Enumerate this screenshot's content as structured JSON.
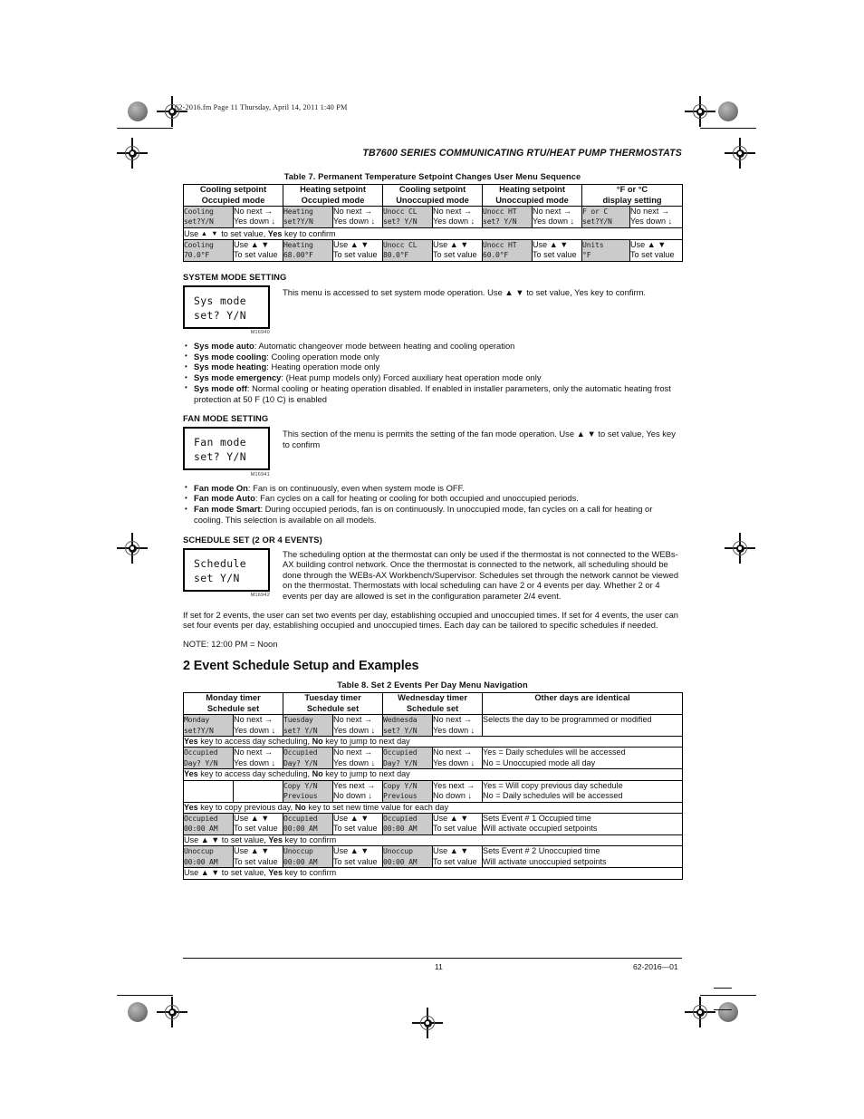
{
  "header": {
    "fm_stamp": "62-2016.fm  Page 11  Thursday, April 14, 2011  1:40 PM",
    "running_head": "TB7600 SERIES COMMUNICATING RTU/HEAT PUMP THERMOSTATS"
  },
  "footer": {
    "page_number": "11",
    "doc_number": "62-2016—01"
  },
  "table7": {
    "caption": "Table 7.  Permanent Temperature Setpoint Changes User Menu Sequence",
    "headers": [
      "Cooling setpoint\nOccupied mode",
      "Heating setpoint\nOccupied mode",
      "Cooling setpoint\nUnoccupied mode",
      "Heating setpoint\nUnoccupied mode",
      "°F or °C\ndisplay setting"
    ],
    "row1": [
      {
        "lcd": "Cooling\nset?Y/N",
        "act": "No next →\nYes down ↓"
      },
      {
        "lcd": "Heating\nset?Y/N",
        "act": "No next →\nYes down ↓"
      },
      {
        "lcd": "Unocc CL\nset? Y/N",
        "act": "No next →\nYes down ↓"
      },
      {
        "lcd": "Unocc HT\nset? Y/N",
        "act": "No next →\nYes down ↓"
      },
      {
        "lcd": "F or C\nset?Y/N",
        "act": "No next →\nYes down ↓"
      }
    ],
    "note1_pre": "Use",
    "note1_mid": "to set value,",
    "note1_key": "Yes",
    "note1_post": "key to confirm",
    "row2": [
      {
        "lcd": "Cooling\n70.0°F",
        "act": "Use ▲  ▼\nTo set value"
      },
      {
        "lcd": "Heating\n68.00°F",
        "act": "Use ▲  ▼\nTo set value"
      },
      {
        "lcd": "Unocc CL\n80.0°F",
        "act": "Use ▲  ▼\nTo set value"
      },
      {
        "lcd": "Unocc HT\n60.0°F",
        "act": "Use ▲  ▼\nTo set value"
      },
      {
        "lcd": "Units\n°F",
        "act": "Use ▲  ▼\nTo set value"
      }
    ]
  },
  "system_mode": {
    "heading": "SYSTEM MODE SETTING",
    "lcd_line1": "Sys mode",
    "lcd_line2": "set? Y/N",
    "fig": "M16940",
    "intro": "This menu is accessed to set system mode operation. Use ▲  ▼ to set value, Yes key to confirm.",
    "bullets": [
      {
        "term": "Sys mode auto",
        "text": ": Automatic changeover mode between heating and cooling operation"
      },
      {
        "term": "Sys mode cooling",
        "text": ": Cooling operation mode only"
      },
      {
        "term": "Sys mode heating",
        "text": ": Heating operation mode only"
      },
      {
        "term": "Sys mode emergency",
        "text": ": (Heat pump models only) Forced auxiliary heat operation mode only"
      },
      {
        "term": "Sys mode off",
        "text": ": Normal cooling or heating operation disabled. If enabled in installer parameters, only the automatic heating frost protection at 50 F (10 C) is enabled"
      }
    ]
  },
  "fan_mode": {
    "heading": "FAN MODE SETTING",
    "lcd_line1": "Fan mode",
    "lcd_line2": "set? Y/N",
    "fig": "M16941",
    "intro": "This section of the menu is permits the setting of the fan mode operation. Use ▲  ▼ to set value, Yes key to confirm",
    "bullets": [
      {
        "term": "Fan mode On",
        "text": ": Fan is on continuously, even when system mode is OFF."
      },
      {
        "term": "Fan mode Auto",
        "text": ": Fan cycles on a call for heating or cooling for both occupied and unoccupied periods."
      },
      {
        "term": "Fan mode Smart",
        "text": ": During occupied periods, fan is on continuously. In unoccupied mode, fan cycles on a call for heating or cooling. This selection is available on all models."
      }
    ]
  },
  "schedule_set": {
    "heading": "SCHEDULE SET (2 OR 4 EVENTS)",
    "lcd_line1": "Schedule",
    "lcd_line2": "set Y/N",
    "fig": "M16942",
    "para1": "The scheduling option at the thermostat can only be used if the thermostat is not connected to the WEBs-AX building control network. Once the thermostat is connected to the network, all scheduling should be done through the WEBs-AX Workbench/Supervisor. Schedules set through the network cannot be viewed on the thermostat. Thermostats with local scheduling can have 2 or 4 events per day. Whether 2 or 4 events per day are allowed is set in the configuration parameter 2/4 event.",
    "para2": "If set for 2 events, the user can set two events per day, establishing occupied and unoccupied times. If set for 4 events, the user can set four events per day, establishing occupied and unoccupied times. Each day can be tailored to specific schedules if needed.",
    "note": "NOTE:   12:00 PM = Noon"
  },
  "section_title": "2 Event Schedule Setup and Examples",
  "table8": {
    "caption": "Table 8. Set 2 Events Per Day Menu Navigation",
    "headers": [
      "Monday timer\nSchedule set",
      "Tuesday timer\nSchedule set",
      "Wednesday timer\nSchedule set",
      "Other days are identical"
    ],
    "rows": [
      {
        "cells": [
          {
            "lcd": "Monday\nset?Y/N",
            "act": "No next →\nYes down ↓"
          },
          {
            "lcd": "Tuesday\nset? Y/N",
            "act": "No next →\nYes down ↓"
          },
          {
            "lcd": "Wednesda\nset? Y/N",
            "act": "No next →\nYes down ↓"
          }
        ],
        "desc": "Selects the day to be programmed or modified",
        "note": {
          "pre": "",
          "k1": "Yes",
          "mid": " key to access day scheduling, ",
          "k2": "No",
          "post": " key to jump to next day"
        }
      },
      {
        "cells": [
          {
            "lcd": "Occupied\nDay? Y/N",
            "act": "No next →\nYes down ↓"
          },
          {
            "lcd": "Occupied\nDay? Y/N",
            "act": "No next →\nYes down ↓"
          },
          {
            "lcd": "Occupied\nDay? Y/N",
            "act": "No next →\nYes down ↓"
          }
        ],
        "desc": "Yes = Daily schedules will be accessed\nNo = Unoccupied mode all day",
        "note": {
          "pre": "",
          "k1": "Yes",
          "mid": " key to access day scheduling, ",
          "k2": "No",
          "post": " key to jump to next day"
        }
      },
      {
        "cells": [
          {
            "lcd": "",
            "act": ""
          },
          {
            "lcd": "Copy Y/N\nPrevious",
            "act": "Yes next →\nNo down ↓"
          },
          {
            "lcd": "Copy Y/N\nPrevious",
            "act": "Yes next →\nNo down ↓"
          }
        ],
        "desc": "Yes = Will copy previous day schedule\nNo = Daily schedules will be accessed",
        "note": {
          "pre": "",
          "k1": "Yes",
          "mid": " key to copy previous day, ",
          "k2": "No",
          "post": " key to set new time value for each day"
        }
      },
      {
        "cells": [
          {
            "lcd": "Occupied\n00:00 AM",
            "act": "Use ▲  ▼\nTo set value"
          },
          {
            "lcd": "Occupied\n00:00 AM",
            "act": "Use ▲  ▼\nTo set value"
          },
          {
            "lcd": "Occupied\n00:00 AM",
            "act": "Use ▲  ▼\nTo set value"
          }
        ],
        "desc": "Sets Event # 1 Occupied time\nWill activate occupied setpoints",
        "note": {
          "pre": "Use ▲  ▼ to set value, ",
          "k1": "Yes",
          "mid": " key to confirm",
          "k2": "",
          "post": ""
        }
      },
      {
        "cells": [
          {
            "lcd": "Unoccup\n00:00 AM",
            "act": "Use ▲  ▼\nTo set value"
          },
          {
            "lcd": "Unoccup\n00:00 AM",
            "act": "Use ▲  ▼\nTo set value"
          },
          {
            "lcd": "Unoccup\n00:00 AM",
            "act": "Use ▲  ▼\nTo set value"
          }
        ],
        "desc": "Sets Event # 2 Unoccupied time\nWill activate unoccupied setpoints",
        "note": {
          "pre": "Use ▲  ▼ to set value, ",
          "k1": "Yes",
          "mid": " key to confirm",
          "k2": "",
          "post": ""
        }
      }
    ]
  }
}
